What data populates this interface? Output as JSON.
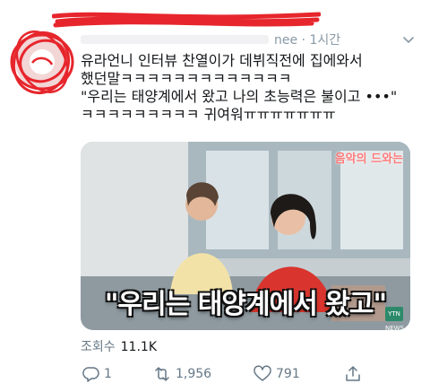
{
  "tweet": {
    "handle_suffix": "nee · 1시간",
    "lines": [
      "유라언니 인터뷰 찬열이가 데뷔직전에 집에와서",
      "했던말ㅋㅋㅋㅋㅋㅋㅋㅋㅋㅋㅋㅋㅋ",
      "\"우리는 태양계에서 왔고 나의 초능력은 불이고 •••\"",
      "ㅋㅋㅋㅋㅋㅋㅋㅋㅋ 귀여워ㅠㅠㅠㅠㅠㅠㅠ"
    ]
  },
  "media": {
    "caption": "\"우리는 태양계에서 왔고\"",
    "watermark": "음악의 드와는",
    "badge": "YTN NEWS"
  },
  "stats": {
    "views_label": "조회수",
    "views_value": "11.1K"
  },
  "actions": {
    "reply_count": "1",
    "retweet_count": "1,956",
    "like_count": "791"
  },
  "colors": {
    "redaction": "#e6262c",
    "muted_text": "#657786"
  }
}
